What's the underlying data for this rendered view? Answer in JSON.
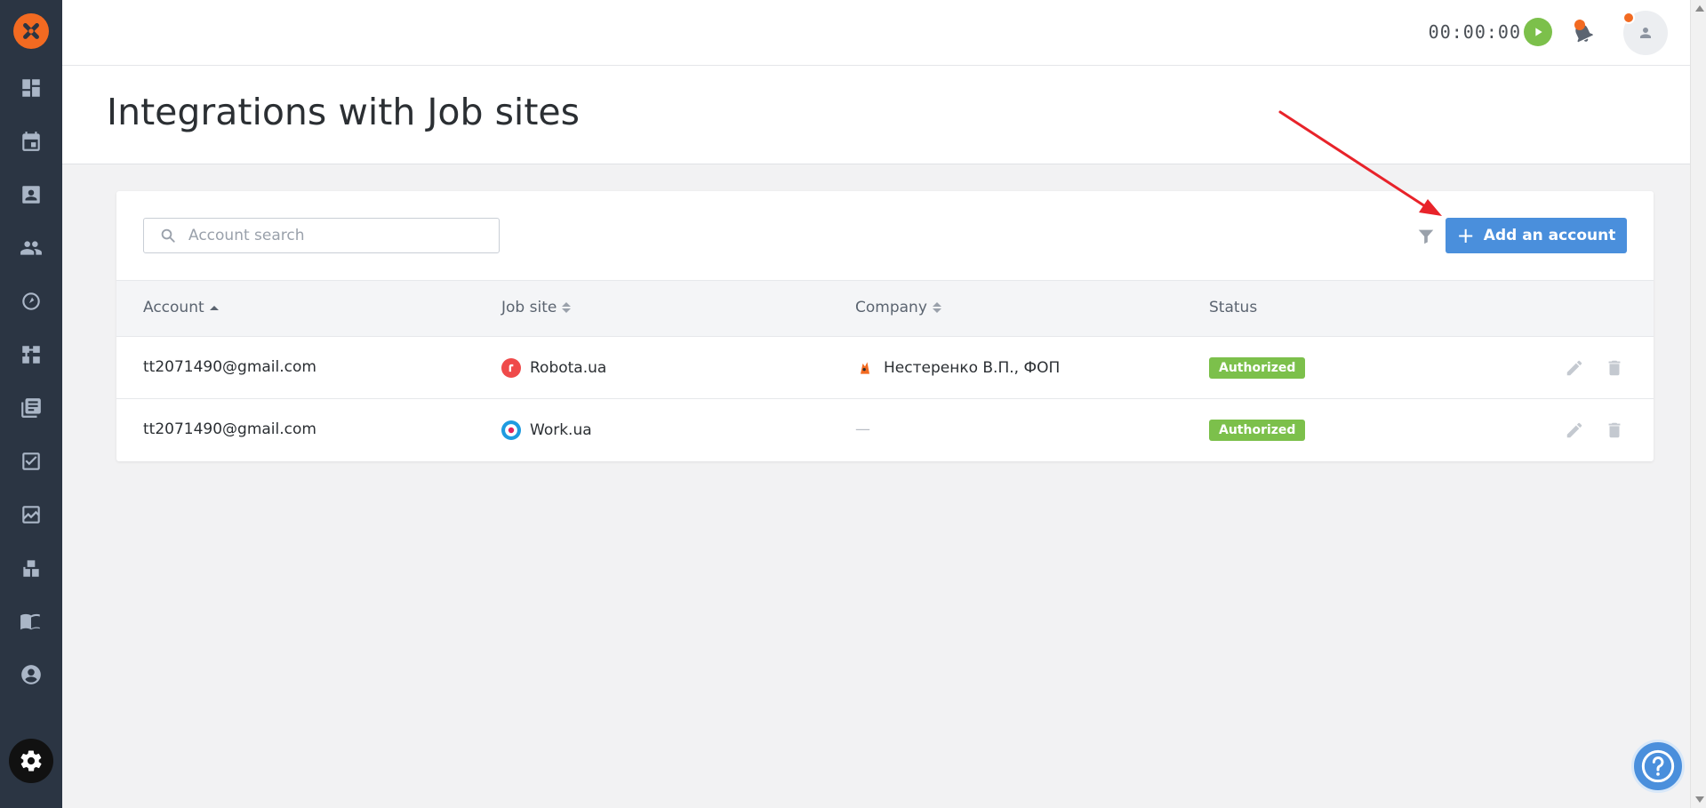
{
  "topbar": {
    "timer": "00:00:00"
  },
  "page": {
    "title": "Integrations with Job sites"
  },
  "search": {
    "placeholder": "Account search"
  },
  "toolbar": {
    "add_label": "Add an account"
  },
  "table": {
    "columns": [
      "Account",
      "Job site",
      "Company",
      "Status"
    ],
    "rows": [
      {
        "account": "tt2071490@gmail.com",
        "job_site": "Robota.ua",
        "company": "Нестеренко В.П., ФОП",
        "status": "Authorized"
      },
      {
        "account": "tt2071490@gmail.com",
        "job_site": "Work.ua",
        "company": "—",
        "status": "Authorized"
      }
    ]
  },
  "colors": {
    "accent": "#4a8fdc",
    "brand": "#f26a21",
    "status_authorized": "#7cc04b",
    "sidebar": "#2b3543"
  },
  "sidebar": {
    "items": [
      "dashboard-icon",
      "calendar-icon",
      "candidates-icon",
      "team-icon",
      "speed-icon",
      "workflow-icon",
      "library-icon",
      "tasks-icon",
      "reports-icon",
      "apps-icon",
      "book-icon",
      "profile-icon",
      "settings-icon"
    ]
  }
}
